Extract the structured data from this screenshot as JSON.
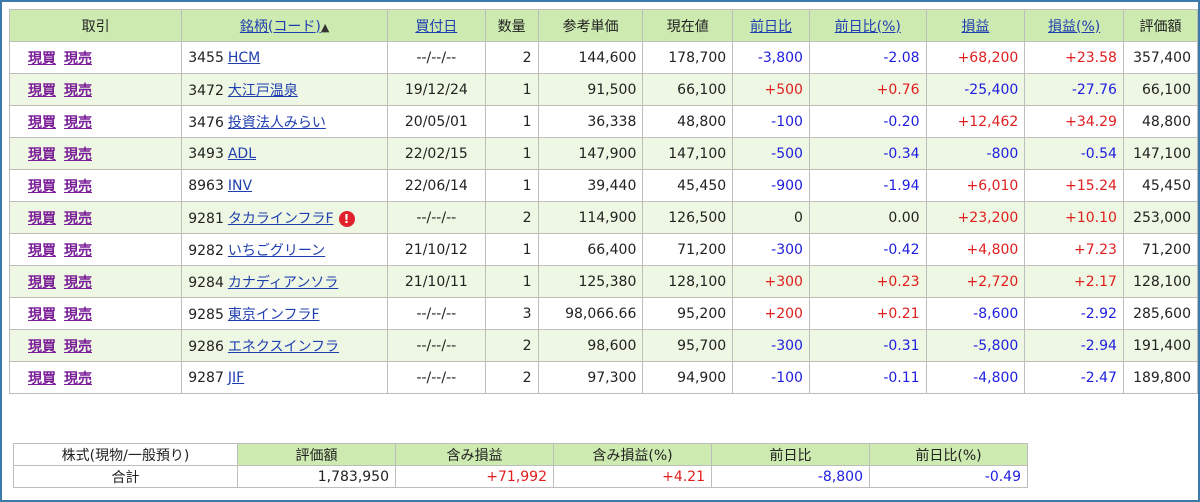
{
  "headers": {
    "trade": "取引",
    "name": "銘柄(コード)",
    "sort_mark": "▲",
    "buy_date": "買付日",
    "qty": "数量",
    "ref_price": "参考単価",
    "current": "現在値",
    "day_change": "前日比",
    "day_change_pct": "前日比(%)",
    "pl": "損益",
    "pl_pct": "損益(%)",
    "value": "評価額"
  },
  "buy_label": "現買",
  "sell_label": "現売",
  "rows": [
    {
      "code": "3455",
      "name": "HCM",
      "date": "--/--/--",
      "qty": "2",
      "ref": "144,600",
      "cur": "178,700",
      "chg": "-3,800",
      "chgpct": "-2.08",
      "pl": "+68,200",
      "plpct": "+23.58",
      "value": "357,400"
    },
    {
      "code": "3472",
      "name": "大江戸温泉",
      "date": "19/12/24",
      "qty": "1",
      "ref": "91,500",
      "cur": "66,100",
      "chg": "+500",
      "chgpct": "+0.76",
      "pl": "-25,400",
      "plpct": "-27.76",
      "value": "66,100"
    },
    {
      "code": "3476",
      "name": "投資法人みらい",
      "date": "20/05/01",
      "qty": "1",
      "ref": "36,338",
      "cur": "48,800",
      "chg": "-100",
      "chgpct": "-0.20",
      "pl": "+12,462",
      "plpct": "+34.29",
      "value": "48,800"
    },
    {
      "code": "3493",
      "name": "ADL",
      "date": "22/02/15",
      "qty": "1",
      "ref": "147,900",
      "cur": "147,100",
      "chg": "-500",
      "chgpct": "-0.34",
      "pl": "-800",
      "plpct": "-0.54",
      "value": "147,100"
    },
    {
      "code": "8963",
      "name": "INV",
      "date": "22/06/14",
      "qty": "1",
      "ref": "39,440",
      "cur": "45,450",
      "chg": "-900",
      "chgpct": "-1.94",
      "pl": "+6,010",
      "plpct": "+15.24",
      "value": "45,450"
    },
    {
      "code": "9281",
      "name": "タカラインフラF",
      "warn": "!",
      "date": "--/--/--",
      "qty": "2",
      "ref": "114,900",
      "cur": "126,500",
      "chg": "0",
      "chgpct": "0.00",
      "pl": "+23,200",
      "plpct": "+10.10",
      "value": "253,000"
    },
    {
      "code": "9282",
      "name": "いちごグリーン",
      "date": "21/10/12",
      "qty": "1",
      "ref": "66,400",
      "cur": "71,200",
      "chg": "-300",
      "chgpct": "-0.42",
      "pl": "+4,800",
      "plpct": "+7.23",
      "value": "71,200"
    },
    {
      "code": "9284",
      "name": "カナディアンソラ",
      "date": "21/10/11",
      "qty": "1",
      "ref": "125,380",
      "cur": "128,100",
      "chg": "+300",
      "chgpct": "+0.23",
      "pl": "+2,720",
      "plpct": "+2.17",
      "value": "128,100"
    },
    {
      "code": "9285",
      "name": "東京インフラF",
      "date": "--/--/--",
      "qty": "3",
      "ref": "98,066.66",
      "cur": "95,200",
      "chg": "+200",
      "chgpct": "+0.21",
      "pl": "-8,600",
      "plpct": "-2.92",
      "value": "285,600"
    },
    {
      "code": "9286",
      "name": "エネクスインフラ",
      "date": "--/--/--",
      "qty": "2",
      "ref": "98,600",
      "cur": "95,700",
      "chg": "-300",
      "chgpct": "-0.31",
      "pl": "-5,800",
      "plpct": "-2.94",
      "value": "191,400"
    },
    {
      "code": "9287",
      "name": "JIF",
      "date": "--/--/--",
      "qty": "2",
      "ref": "97,300",
      "cur": "94,900",
      "chg": "-100",
      "chgpct": "-0.11",
      "pl": "-4,800",
      "plpct": "-2.47",
      "value": "189,800"
    }
  ],
  "summary": {
    "label_line1": "株式(現物/一般預り)",
    "label_line2": "合計",
    "headers": [
      "評価額",
      "含み損益",
      "含み損益(%)",
      "前日比",
      "前日比(%)"
    ],
    "values": [
      "1,783,950",
      "+71,992",
      "+4.21",
      "-8,800",
      "-0.49"
    ]
  },
  "colors": {
    "positive": "#e01e1e",
    "negative": "#1e1ee0",
    "header_bg": "#cdeab0",
    "stripe": "#eef7e3",
    "link": "#1f3fb0",
    "trade_link": "#7a1f98"
  }
}
